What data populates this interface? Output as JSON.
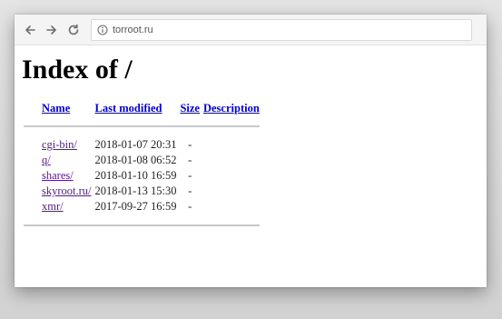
{
  "browser": {
    "url": "torroot.ru",
    "icons": {
      "back": "back-arrow-icon",
      "forward": "forward-arrow-icon",
      "reload": "reload-icon",
      "info": "info-icon"
    }
  },
  "page": {
    "title": "Index of /",
    "columns": {
      "name": "Name",
      "last_modified": "Last modified",
      "size": "Size",
      "description": "Description"
    },
    "rows": [
      {
        "name": "cgi-bin/",
        "modified": "2018-01-07 20:31",
        "size": "-",
        "description": ""
      },
      {
        "name": "q/",
        "modified": "2018-01-08 06:52",
        "size": "-",
        "description": ""
      },
      {
        "name": "shares/",
        "modified": "2018-01-10 16:59",
        "size": "-",
        "description": ""
      },
      {
        "name": "skyroot.ru/",
        "modified": "2018-01-13 15:30",
        "size": "-",
        "description": ""
      },
      {
        "name": "xmr/",
        "modified": "2017-09-27 16:59",
        "size": "-",
        "description": ""
      }
    ]
  },
  "colors": {
    "header_link": "#0000cc",
    "visited_link": "#551a8b",
    "rule": "#c8c8c8"
  }
}
